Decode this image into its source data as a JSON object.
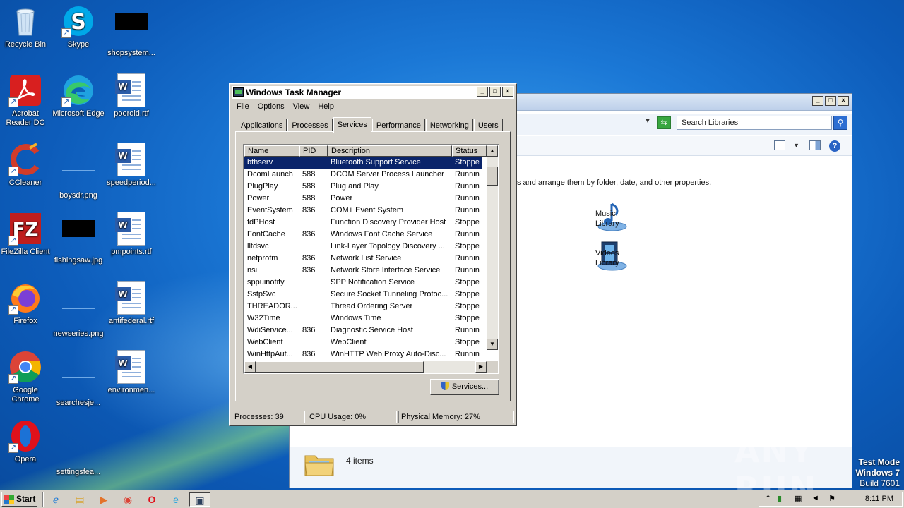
{
  "desktop": {
    "icons": [
      {
        "label": "Recycle Bin",
        "icon": "recycle-bin-icon"
      },
      {
        "label": "Skype",
        "icon": "skype-icon"
      },
      {
        "label": "shopsystem...",
        "icon": "image-thumbnail-icon"
      },
      {
        "label": "Acrobat Reader DC",
        "icon": "acrobat-icon"
      },
      {
        "label": "Microsoft Edge",
        "icon": "edge-icon"
      },
      {
        "label": "poorold.rtf",
        "icon": "word-document-icon"
      },
      {
        "label": "CCleaner",
        "icon": "ccleaner-icon"
      },
      {
        "label": "boysdr.png",
        "icon": "image-thumbnail-icon"
      },
      {
        "label": "speedperiod...",
        "icon": "word-document-icon"
      },
      {
        "label": "FileZilla Client",
        "icon": "filezilla-icon"
      },
      {
        "label": "fishingsaw.jpg",
        "icon": "image-thumbnail-icon"
      },
      {
        "label": "pmpoints.rtf",
        "icon": "word-document-icon"
      },
      {
        "label": "Firefox",
        "icon": "firefox-icon"
      },
      {
        "label": "newseries.png",
        "icon": "image-thumbnail-icon"
      },
      {
        "label": "antifederal.rtf",
        "icon": "word-document-icon"
      },
      {
        "label": "Google Chrome",
        "icon": "chrome-icon"
      },
      {
        "label": "searchesje...",
        "icon": "image-thumbnail-icon"
      },
      {
        "label": "environmen...",
        "icon": "word-document-icon"
      },
      {
        "label": "Opera",
        "icon": "opera-icon"
      },
      {
        "label": "settingsfea...",
        "icon": "image-thumbnail-icon"
      }
    ]
  },
  "explorer": {
    "search_placeholder": "Search Libraries",
    "description": "s and arrange them by folder, date, and other properties.",
    "libraries": [
      {
        "line1": "Music",
        "line2": "Library",
        "icon": "music-library-icon"
      },
      {
        "line1": "Videos",
        "line2": "Library",
        "icon": "videos-library-icon"
      }
    ],
    "status_items": "4 items"
  },
  "taskmanager": {
    "title": "Windows Task Manager",
    "menu": [
      "File",
      "Options",
      "View",
      "Help"
    ],
    "tabs": [
      "Applications",
      "Processes",
      "Services",
      "Performance",
      "Networking",
      "Users"
    ],
    "active_tab": "Services",
    "columns": [
      "Name",
      "PID",
      "Description",
      "Status"
    ],
    "rows": [
      {
        "name": "bthserv",
        "pid": "",
        "desc": "Bluetooth Support Service",
        "status": "Stoppe"
      },
      {
        "name": "DcomLaunch",
        "pid": "588",
        "desc": "DCOM Server Process Launcher",
        "status": "Runnin"
      },
      {
        "name": "PlugPlay",
        "pid": "588",
        "desc": "Plug and Play",
        "status": "Runnin"
      },
      {
        "name": "Power",
        "pid": "588",
        "desc": "Power",
        "status": "Runnin"
      },
      {
        "name": "EventSystem",
        "pid": "836",
        "desc": "COM+ Event System",
        "status": "Runnin"
      },
      {
        "name": "fdPHost",
        "pid": "",
        "desc": "Function Discovery Provider Host",
        "status": "Stoppe"
      },
      {
        "name": "FontCache",
        "pid": "836",
        "desc": "Windows Font Cache Service",
        "status": "Runnin"
      },
      {
        "name": "lltdsvc",
        "pid": "",
        "desc": "Link-Layer Topology Discovery ...",
        "status": "Stoppe"
      },
      {
        "name": "netprofm",
        "pid": "836",
        "desc": "Network List Service",
        "status": "Runnin"
      },
      {
        "name": "nsi",
        "pid": "836",
        "desc": "Network Store Interface Service",
        "status": "Runnin"
      },
      {
        "name": "sppuinotify",
        "pid": "",
        "desc": "SPP Notification Service",
        "status": "Stoppe"
      },
      {
        "name": "SstpSvc",
        "pid": "",
        "desc": "Secure Socket Tunneling Protoc...",
        "status": "Stoppe"
      },
      {
        "name": "THREADOR...",
        "pid": "",
        "desc": "Thread Ordering Server",
        "status": "Stoppe"
      },
      {
        "name": "W32Time",
        "pid": "",
        "desc": "Windows Time",
        "status": "Stoppe"
      },
      {
        "name": "WdiService...",
        "pid": "836",
        "desc": "Diagnostic Service Host",
        "status": "Runnin"
      },
      {
        "name": "WebClient",
        "pid": "",
        "desc": "WebClient",
        "status": "Stoppe"
      },
      {
        "name": "WinHttpAut...",
        "pid": "836",
        "desc": "WinHTTP Web Proxy Auto-Disc...",
        "status": "Runnin"
      }
    ],
    "selected_row": 0,
    "services_button": "Services...",
    "status": {
      "processes": "Processes: 39",
      "cpu": "CPU Usage: 0%",
      "memory": "Physical Memory: 27%"
    }
  },
  "watermark": "ANY RUN",
  "testmode": {
    "line1": "Test Mode",
    "line2": "Windows 7",
    "line3": "Build 7601"
  },
  "taskbar": {
    "start_label": "Start",
    "pinned": [
      "ie-icon",
      "explorer-icon",
      "media-player-icon",
      "chrome-icon",
      "opera-icon",
      "edge-icon",
      "taskmanager-icon"
    ],
    "clock": "8:11 PM"
  }
}
